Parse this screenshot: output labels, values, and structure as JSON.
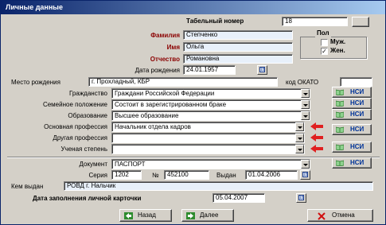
{
  "window": {
    "title": "Личные данные"
  },
  "tab_number": {
    "label": "Табельный номер",
    "value": "18"
  },
  "name": {
    "surname_label": "Фамилия",
    "surname": "Степченко",
    "first_label": "Имя",
    "first": "Ольга",
    "patronymic_label": "Отчество",
    "patronymic": "Романовна"
  },
  "gender": {
    "title": "Пол",
    "male": "Муж.",
    "female": "Жен.",
    "male_checked": false,
    "female_checked": true,
    "check_mark": "✓"
  },
  "birth": {
    "date_label": "Дата рождения",
    "date": "24.01.1957",
    "place_label": "Место рождения",
    "place": "г. Прохладный, КБР",
    "okato_label": "код ОКАТО",
    "okato": ""
  },
  "fields": {
    "citizenship_label": "Гражданство",
    "citizenship": "Граждани Российской Федерации",
    "marital_label": "Семейное положение",
    "marital": "Состоит в зарегистрированном браке",
    "education_label": "Образование",
    "education": "Высшее образование",
    "main_prof_label": "Основная профессия",
    "main_prof": "Начальник отдела кадров",
    "other_prof_label": "Другая профессия",
    "other_prof": "",
    "degree_label": "Ученая степень",
    "degree": ""
  },
  "nsi_label": "НСИ",
  "document": {
    "label": "Документ",
    "value": "ПАСПОРТ",
    "series_label": "Серия",
    "series": "1202",
    "number_label": "№",
    "number": "452100",
    "issued_label": "Выдан",
    "issued": "01.04.2006",
    "issuer_label": "Кем выдан",
    "issuer": "РОВД г. Нальчик"
  },
  "card": {
    "label": "Дата заполнения личной карточки",
    "date": "05.04.2007"
  },
  "buttons": {
    "back": "Назад",
    "next": "Далее",
    "cancel": "Отмена"
  },
  "calendar_glyph": "15",
  "colors": {
    "title_start": "#0a246a",
    "required_label": "#8b0000",
    "arrow": "#e02020",
    "nsi_text": "#003399"
  }
}
